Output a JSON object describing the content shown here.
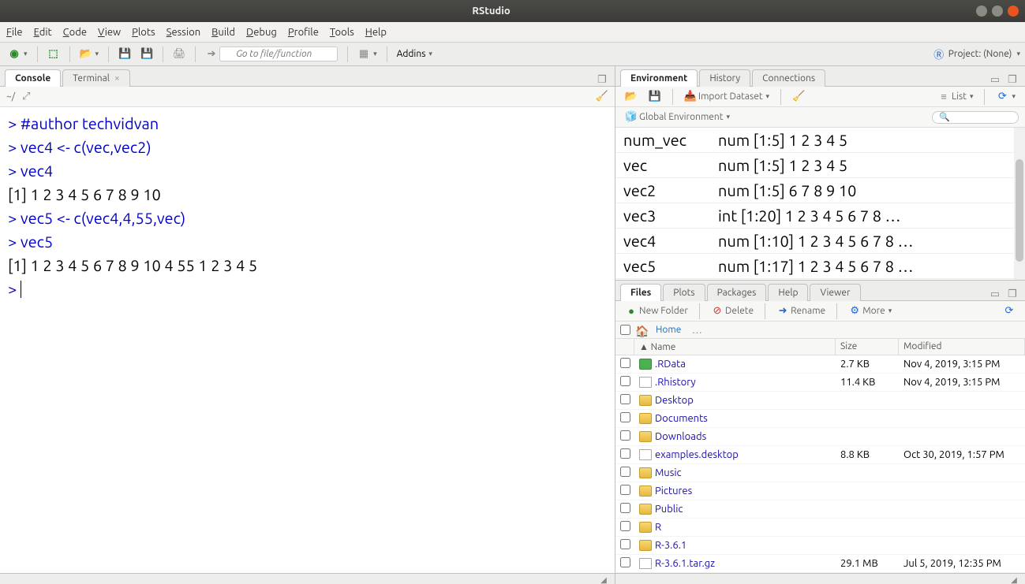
{
  "window": {
    "title": "RStudio"
  },
  "menu": [
    "File",
    "Edit",
    "Code",
    "View",
    "Plots",
    "Session",
    "Build",
    "Debug",
    "Profile",
    "Tools",
    "Help"
  ],
  "toolbar": {
    "goto_placeholder": "Go to file/function",
    "addins_label": "Addins",
    "project_label": "Project: (None)"
  },
  "left": {
    "tabs": {
      "console": "Console",
      "terminal": "Terminal"
    },
    "prompt_path": "~/",
    "console_lines": [
      {
        "type": "cmd",
        "text": "#author techvidvan"
      },
      {
        "type": "cmd",
        "text": "vec4 <- c(vec,vec2)"
      },
      {
        "type": "cmd",
        "text": "vec4"
      },
      {
        "type": "out",
        "text": " [1]  1  2  3  4  5  6  7  8  9 10"
      },
      {
        "type": "cmd",
        "text": "vec5 <- c(vec4,4,55,vec)"
      },
      {
        "type": "cmd",
        "text": "vec5"
      },
      {
        "type": "out",
        "text": " [1]  1  2  3  4  5  6  7  8  9 10  4 55  1  2  3  4  5"
      }
    ]
  },
  "env": {
    "tabs": [
      "Environment",
      "History",
      "Connections"
    ],
    "import_label": "Import Dataset",
    "scope_label": "Global Environment",
    "view_label": "List",
    "vars": [
      {
        "name": "num_vec",
        "value": "num [1:5] 1 2 3 4 5"
      },
      {
        "name": "vec",
        "value": "num [1:5] 1 2 3 4 5"
      },
      {
        "name": "vec2",
        "value": "num [1:5] 6 7 8 9 10"
      },
      {
        "name": "vec3",
        "value": "int [1:20] 1 2 3 4 5 6 7 8 …"
      },
      {
        "name": "vec4",
        "value": "num [1:10] 1 2 3 4 5 6 7 8 …"
      },
      {
        "name": "vec5",
        "value": "num [1:17] 1 2 3 4 5 6 7 8 …"
      }
    ]
  },
  "files": {
    "tabs": [
      "Files",
      "Plots",
      "Packages",
      "Help",
      "Viewer"
    ],
    "buttons": {
      "new_folder": "New Folder",
      "delete": "Delete",
      "rename": "Rename",
      "more": "More"
    },
    "breadcrumb": "Home",
    "columns": {
      "name": "Name",
      "size": "Size",
      "modified": "Modified"
    },
    "rows": [
      {
        "icon": "rdata",
        "name": ".RData",
        "size": "2.7 KB",
        "modified": "Nov 4, 2019, 3:15 PM"
      },
      {
        "icon": "doc",
        "name": ".Rhistory",
        "size": "11.4 KB",
        "modified": "Nov 4, 2019, 3:15 PM"
      },
      {
        "icon": "folder",
        "name": "Desktop",
        "size": "",
        "modified": ""
      },
      {
        "icon": "folder",
        "name": "Documents",
        "size": "",
        "modified": ""
      },
      {
        "icon": "folder",
        "name": "Downloads",
        "size": "",
        "modified": ""
      },
      {
        "icon": "doc",
        "name": "examples.desktop",
        "size": "8.8 KB",
        "modified": "Oct 30, 2019, 1:57 PM"
      },
      {
        "icon": "folder",
        "name": "Music",
        "size": "",
        "modified": ""
      },
      {
        "icon": "folder",
        "name": "Pictures",
        "size": "",
        "modified": ""
      },
      {
        "icon": "folder",
        "name": "Public",
        "size": "",
        "modified": ""
      },
      {
        "icon": "folder",
        "name": "R",
        "size": "",
        "modified": ""
      },
      {
        "icon": "folder",
        "name": "R-3.6.1",
        "size": "",
        "modified": ""
      },
      {
        "icon": "doc",
        "name": "R-3.6.1.tar.gz",
        "size": "29.1 MB",
        "modified": "Jul 5, 2019, 12:35 PM"
      }
    ]
  }
}
